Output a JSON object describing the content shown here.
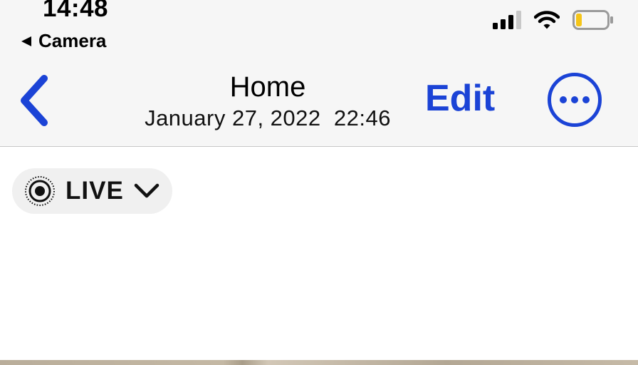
{
  "status_bar": {
    "time": "14:48",
    "back_app_label": "Camera",
    "signal_icon": "cellular-signal-icon",
    "wifi_icon": "wifi-icon",
    "battery_icon": "battery-low-icon",
    "battery_fill_color": "#f5c518"
  },
  "nav": {
    "back_icon": "chevron-left-icon",
    "title": "Home",
    "subtitle": "January 27, 2022  22:46",
    "edit_label": "Edit",
    "more_icon": "ellipsis-circle-icon",
    "accent_color": "#1b43d6"
  },
  "live_control": {
    "icon": "live-photo-icon",
    "label": "LIVE",
    "dropdown_icon": "chevron-down-icon"
  }
}
